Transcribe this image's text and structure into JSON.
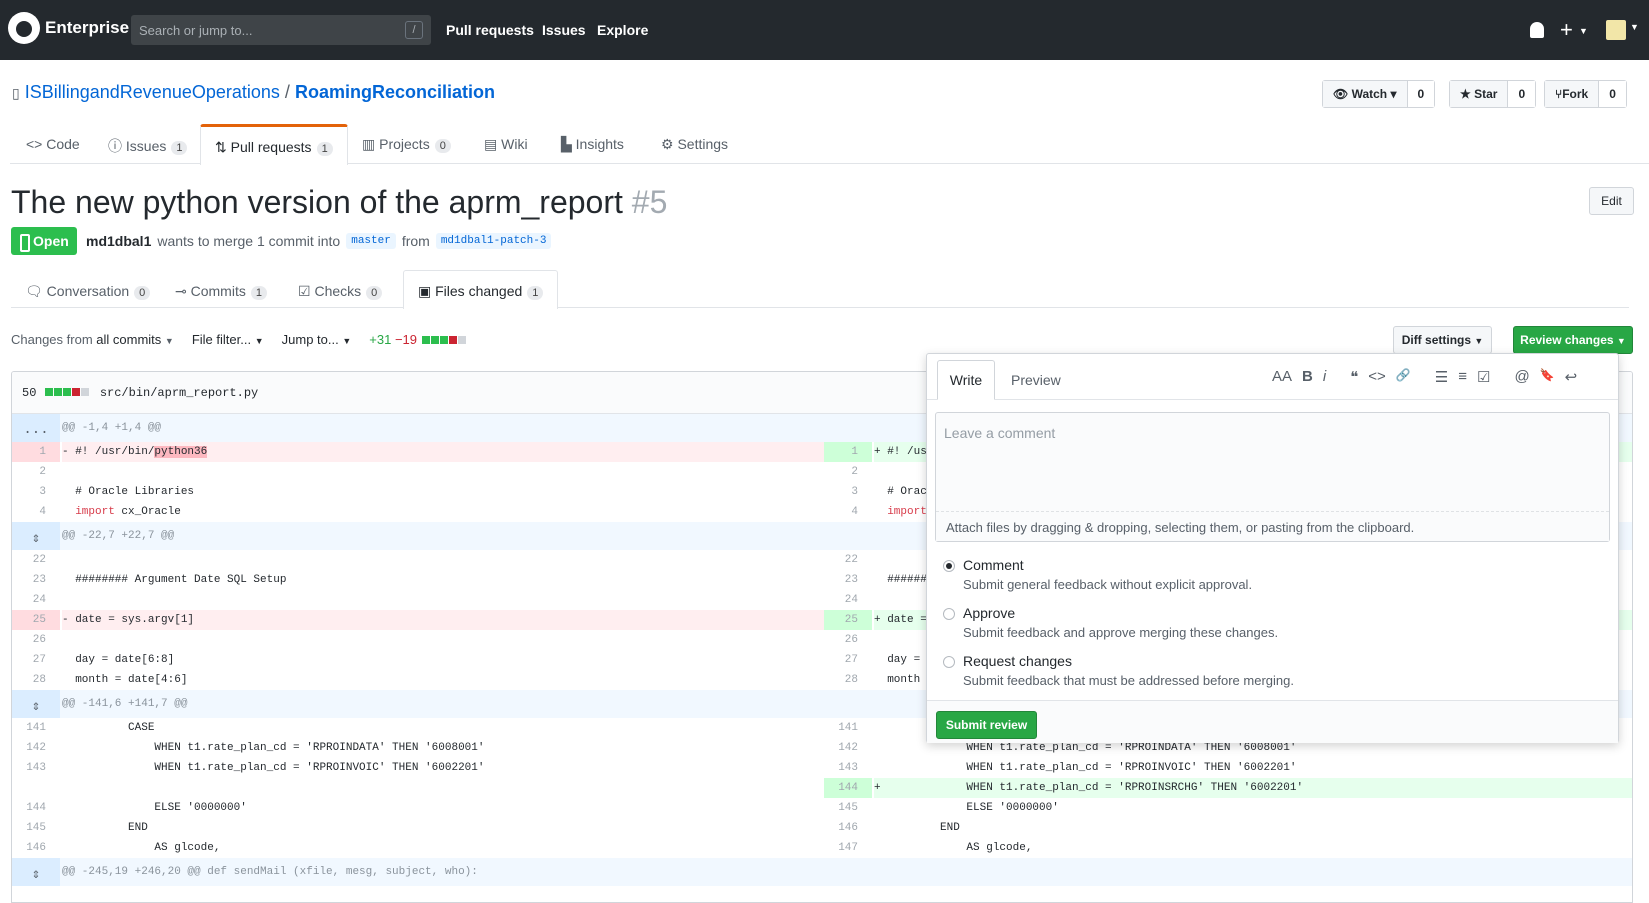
{
  "topbar": {
    "brand": "Enterprise",
    "search_placeholder": "Search or jump to...",
    "slash": "/",
    "nav": [
      "Pull requests",
      "Issues",
      "Explore"
    ],
    "plus": "+"
  },
  "repo": {
    "owner": "ISBillingandRevenueOperations",
    "sep": "/",
    "name": "RoamingReconciliation",
    "watch": {
      "label": "Watch",
      "count": "0"
    },
    "star": {
      "label": "Star",
      "count": "0"
    },
    "fork": {
      "label": "Fork",
      "count": "0"
    }
  },
  "repo_tabs": [
    {
      "label": "Code",
      "count": ""
    },
    {
      "label": "Issues",
      "count": "1"
    },
    {
      "label": "Pull requests",
      "count": "1"
    },
    {
      "label": "Projects",
      "count": "0"
    },
    {
      "label": "Wiki",
      "count": ""
    },
    {
      "label": "Insights",
      "count": ""
    },
    {
      "label": "Settings",
      "count": ""
    }
  ],
  "pr": {
    "title": "The new python version of the aprm_report",
    "number": "#5",
    "edit": "Edit",
    "state": "Open",
    "author": "md1dbal1",
    "merge_text": "wants to merge 1 commit into",
    "base": "master",
    "from": "from",
    "head": "md1dbal1-patch-3"
  },
  "pr_tabs": [
    {
      "label": "Conversation",
      "count": "0"
    },
    {
      "label": "Commits",
      "count": "1"
    },
    {
      "label": "Checks",
      "count": "0"
    },
    {
      "label": "Files changed",
      "count": "1"
    }
  ],
  "toolbar": {
    "changes_from": "Changes from",
    "all_commits": "all commits",
    "file_filter": "File filter...",
    "jump_to": "Jump to...",
    "additions": "+31",
    "deletions": "−19",
    "diff_settings": "Diff settings",
    "review_changes": "Review changes"
  },
  "file": {
    "count": "50",
    "path": "src/bin/aprm_report.py"
  },
  "diff_rows": [
    {
      "type": "hunk",
      "ln": "...",
      "text": "@@ -1,4 +1,4 @@"
    },
    {
      "type": "change",
      "ln": "1",
      "ln2": "1",
      "text": "- #! /usr/bin/",
      "hl": "python36",
      "text2": "+ #! /usr"
    },
    {
      "type": "ctx",
      "ln": "2",
      "ln2": "2",
      "text": "",
      "text2": ""
    },
    {
      "type": "ctx",
      "ln": "3",
      "ln2": "3",
      "text": "  # Oracle Libraries",
      "text2": "  # Oracl"
    },
    {
      "type": "ctxkw",
      "ln": "4",
      "ln2": "4",
      "kw": "import",
      "text": " cx_Oracle",
      "kw2": "import"
    },
    {
      "type": "hunk",
      "ln": "⇕",
      "text": "@@ -22,7 +22,7 @@"
    },
    {
      "type": "ctx",
      "ln": "22",
      "ln2": "22",
      "text": "",
      "text2": ""
    },
    {
      "type": "ctx",
      "ln": "23",
      "ln2": "23",
      "text": "  ######## Argument Date SQL Setup",
      "text2": "  ########"
    },
    {
      "type": "ctx",
      "ln": "24",
      "ln2": "24",
      "text": "",
      "text2": ""
    },
    {
      "type": "change",
      "ln": "25",
      "ln2": "25",
      "text": "- date = sys.argv[1]",
      "hl": "",
      "text2": "+ date ="
    },
    {
      "type": "ctx",
      "ln": "26",
      "ln2": "26",
      "text": "",
      "text2": ""
    },
    {
      "type": "ctx",
      "ln": "27",
      "ln2": "27",
      "text": "  day = date[6:8]",
      "text2": "  day = d"
    },
    {
      "type": "ctx",
      "ln": "28",
      "ln2": "28",
      "text": "  month = date[4:6]",
      "text2": "  month ="
    },
    {
      "type": "hunk",
      "ln": "⇕",
      "text": "@@ -141,6 +141,7 @@"
    },
    {
      "type": "ctx",
      "ln": "141",
      "ln2": "141",
      "text": "          CASE",
      "text2": ""
    },
    {
      "type": "ctx",
      "ln": "142",
      "ln2": "142",
      "text": "              WHEN t1.rate_plan_cd = 'RPROINDATA' THEN '6008001'",
      "text2": "              WHEN t1.rate_plan_cd = 'RPROINDATA' THEN '6008001'"
    },
    {
      "type": "ctx",
      "ln": "143",
      "ln2": "143",
      "text": "              WHEN t1.rate_plan_cd = 'RPROINVOIC' THEN '6002201'",
      "text2": "              WHEN t1.rate_plan_cd = 'RPROINVOIC' THEN '6002201'"
    },
    {
      "type": "addonly",
      "ln": "",
      "ln2": "144",
      "text": "",
      "text2": "+             WHEN t1.rate_plan_cd = 'RPROINSRCHG' THEN '6002201'"
    },
    {
      "type": "ctx",
      "ln": "144",
      "ln2": "145",
      "text": "              ELSE '0000000'",
      "text2": "              ELSE '0000000'"
    },
    {
      "type": "ctx",
      "ln": "145",
      "ln2": "146",
      "text": "          END",
      "text2": "          END"
    },
    {
      "type": "ctx",
      "ln": "146",
      "ln2": "147",
      "text": "              AS glcode,",
      "text2": "              AS glcode,"
    },
    {
      "type": "hunk",
      "ln": "⇕",
      "text": "@@ -245,19 +246,20 @@ def sendMail (xfile, mesg, subject, who):"
    }
  ],
  "review_panel": {
    "tab_write": "Write",
    "tab_preview": "Preview",
    "tools": [
      "AA",
      "B",
      "i",
      "❝",
      "<>",
      "🔗",
      "☰",
      "≡",
      "☑",
      "@",
      "🔖",
      "↩"
    ],
    "placeholder": "Leave a comment",
    "attach": "Attach files by dragging & dropping, selecting them, or pasting from the clipboard.",
    "options": [
      {
        "label": "Comment",
        "desc": "Submit general feedback without explicit approval.",
        "checked": true
      },
      {
        "label": "Approve",
        "desc": "Submit feedback and approve merging these changes.",
        "checked": false
      },
      {
        "label": "Request changes",
        "desc": "Submit feedback that must be addressed before merging.",
        "checked": false
      }
    ],
    "submit": "Submit review"
  }
}
